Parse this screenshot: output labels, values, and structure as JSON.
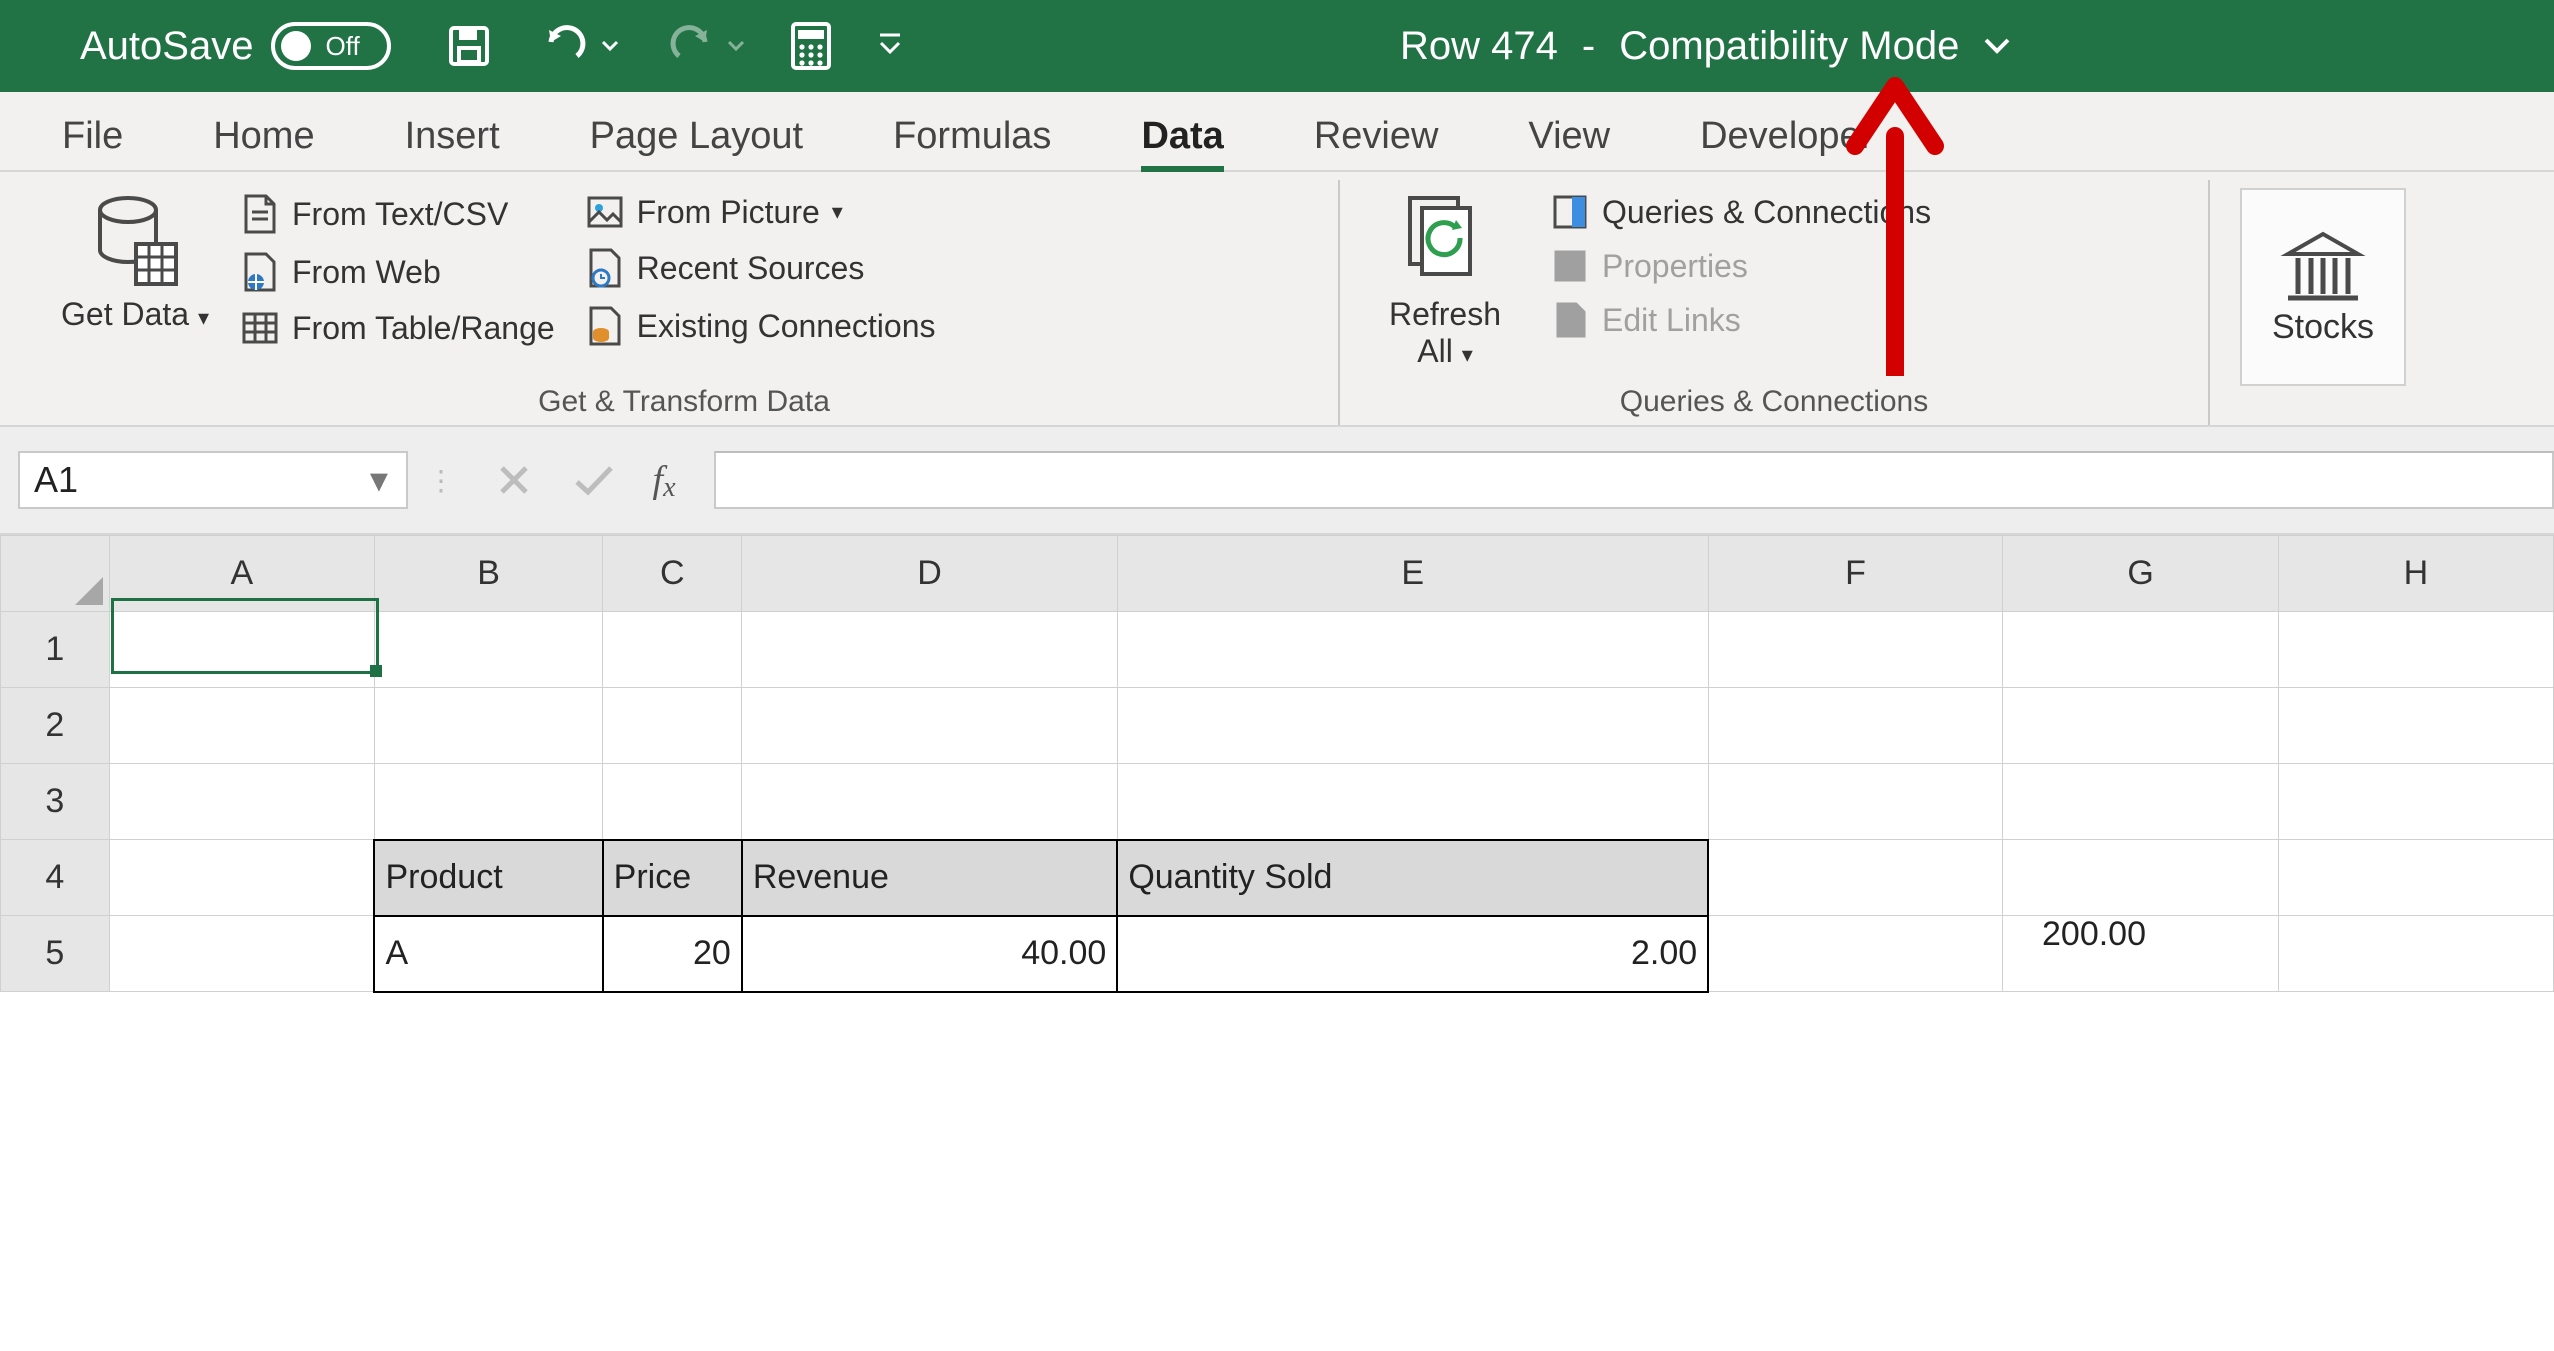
{
  "titlebar": {
    "autosave_label": "AutoSave",
    "autosave_state": "Off",
    "doc_name": "Row 474",
    "mode": "Compatibility Mode"
  },
  "tabs": {
    "items": [
      "File",
      "Home",
      "Insert",
      "Page Layout",
      "Formulas",
      "Data",
      "Review",
      "View",
      "Developer"
    ],
    "active": "Data"
  },
  "ribbon": {
    "get_data": {
      "big": "Get Data",
      "from_text_csv": "From Text/CSV",
      "from_web": "From Web",
      "from_table_range": "From Table/Range",
      "from_picture": "From Picture",
      "recent_sources": "Recent Sources",
      "existing_connections": "Existing Connections",
      "group_label": "Get & Transform Data"
    },
    "queries": {
      "big": "Refresh All",
      "queries_connections": "Queries & Connections",
      "properties": "Properties",
      "edit_links": "Edit Links",
      "group_label": "Queries & Connections"
    },
    "stocks": "Stocks"
  },
  "formulabar": {
    "name": "A1",
    "formula": ""
  },
  "grid": {
    "columns": [
      "A",
      "B",
      "C",
      "D",
      "E",
      "F",
      "G",
      "H"
    ],
    "rows": [
      "1",
      "2",
      "3",
      "4",
      "5"
    ],
    "header": {
      "b": "Product",
      "c": "Price",
      "d": "Revenue",
      "e": "Quantity Sold"
    },
    "row5": {
      "b": "A",
      "c": "20",
      "d": "40.00",
      "e": "2.00"
    },
    "float_g": "200.00"
  },
  "annotation": {
    "arrow_color": "#d30000"
  }
}
